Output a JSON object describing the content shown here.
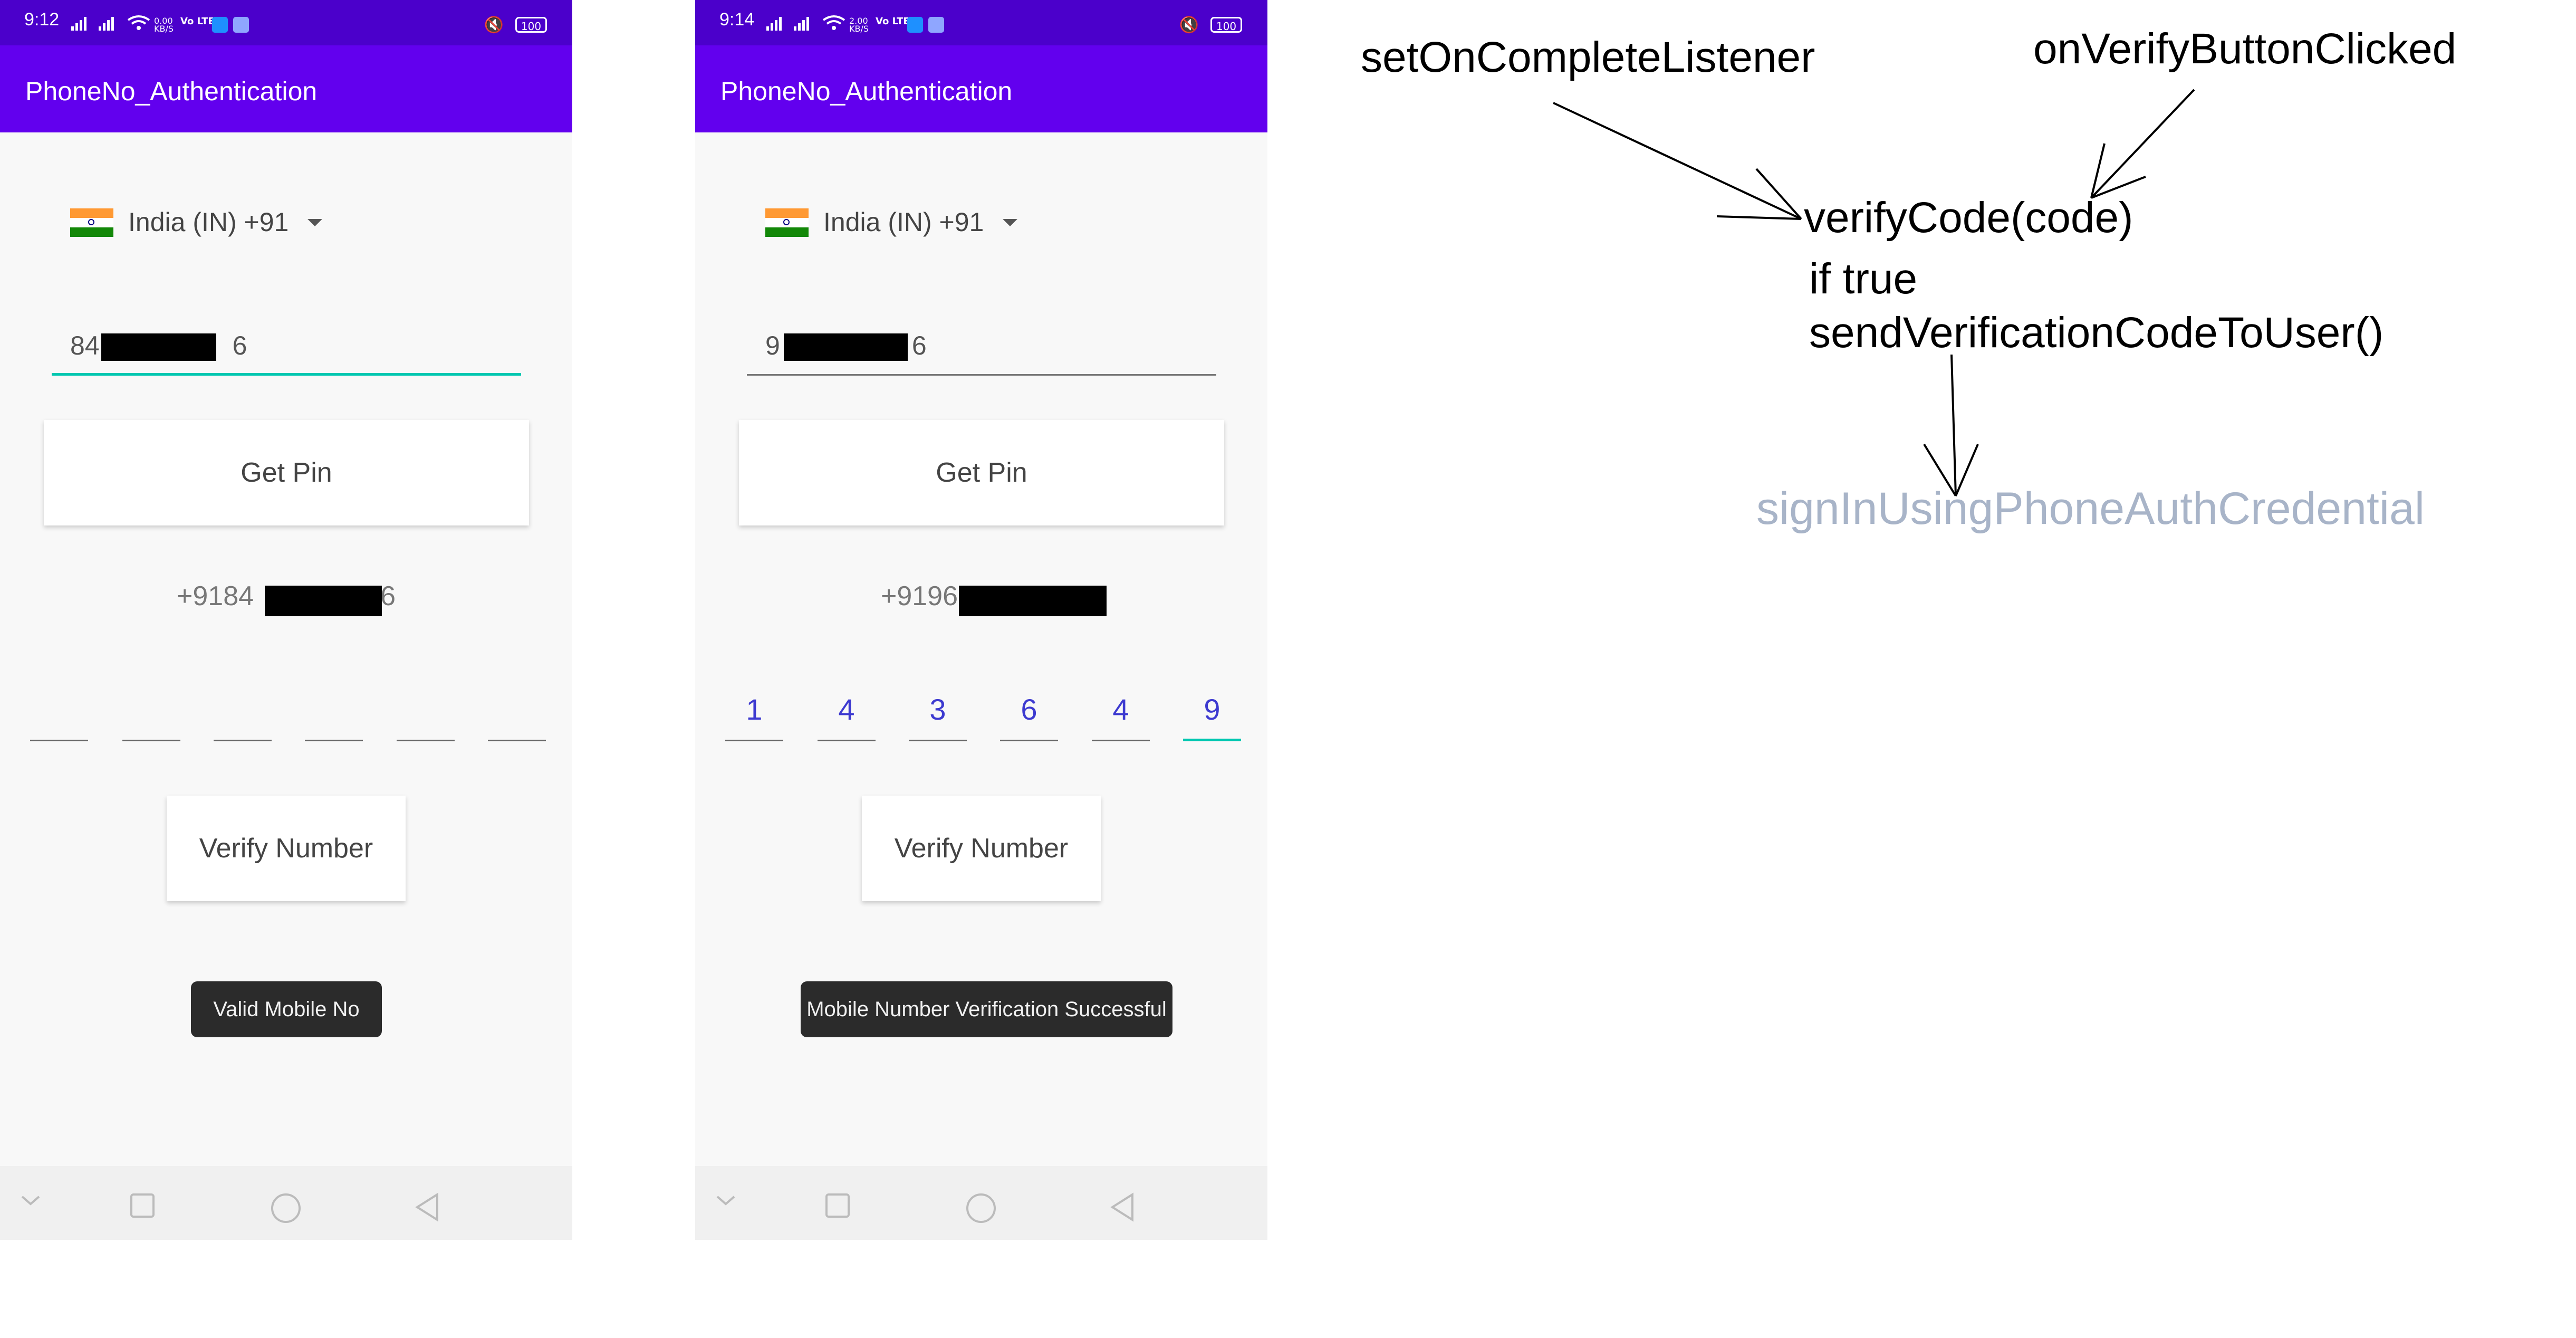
{
  "left": {
    "status": {
      "time": "9:12",
      "speed": "0.00\nKB/S",
      "battery": "100"
    },
    "app_title": "PhoneNo_Authentication",
    "country": "India (IN)  +91",
    "phone_value_prefix": "84",
    "phone_value_suffix": "6",
    "get_pin": "Get Pin",
    "number_prefix": "+9184",
    "number_suffix": "6",
    "otp_digits": [
      "",
      "",
      "",
      "",
      "",
      ""
    ],
    "verify": "Verify Number",
    "toast": "Valid Mobile No"
  },
  "right": {
    "status": {
      "time": "9:14",
      "speed": "2.00\nKB/S",
      "battery": "100"
    },
    "app_title": "PhoneNo_Authentication",
    "country": "India (IN)  +91",
    "phone_value_prefix": "9",
    "phone_value_suffix": "6",
    "get_pin": "Get Pin",
    "number_prefix": "+9196",
    "number_suffix": "",
    "otp_digits": [
      "1",
      "4",
      "3",
      "6",
      "4",
      "9"
    ],
    "verify": "Verify Number",
    "toast": "Mobile Number Verification Successful"
  },
  "annotation": {
    "set_on_complete": "setOnCompleteListener",
    "on_verify_clicked": "onVerifyButtonClicked",
    "verify_code": "verifyCode(code)",
    "if_true": "if true",
    "send_code": "sendVerificationCodeToUser()",
    "sign_in": "signInUsingPhoneAuthCredential",
    "sign_in_color": "#a8b4c8"
  },
  "colors": {
    "status_bar": "#4b00cb",
    "app_bar": "#6200ee",
    "accent": "#00c7b0",
    "otp_digit": "#3d3ad0"
  }
}
